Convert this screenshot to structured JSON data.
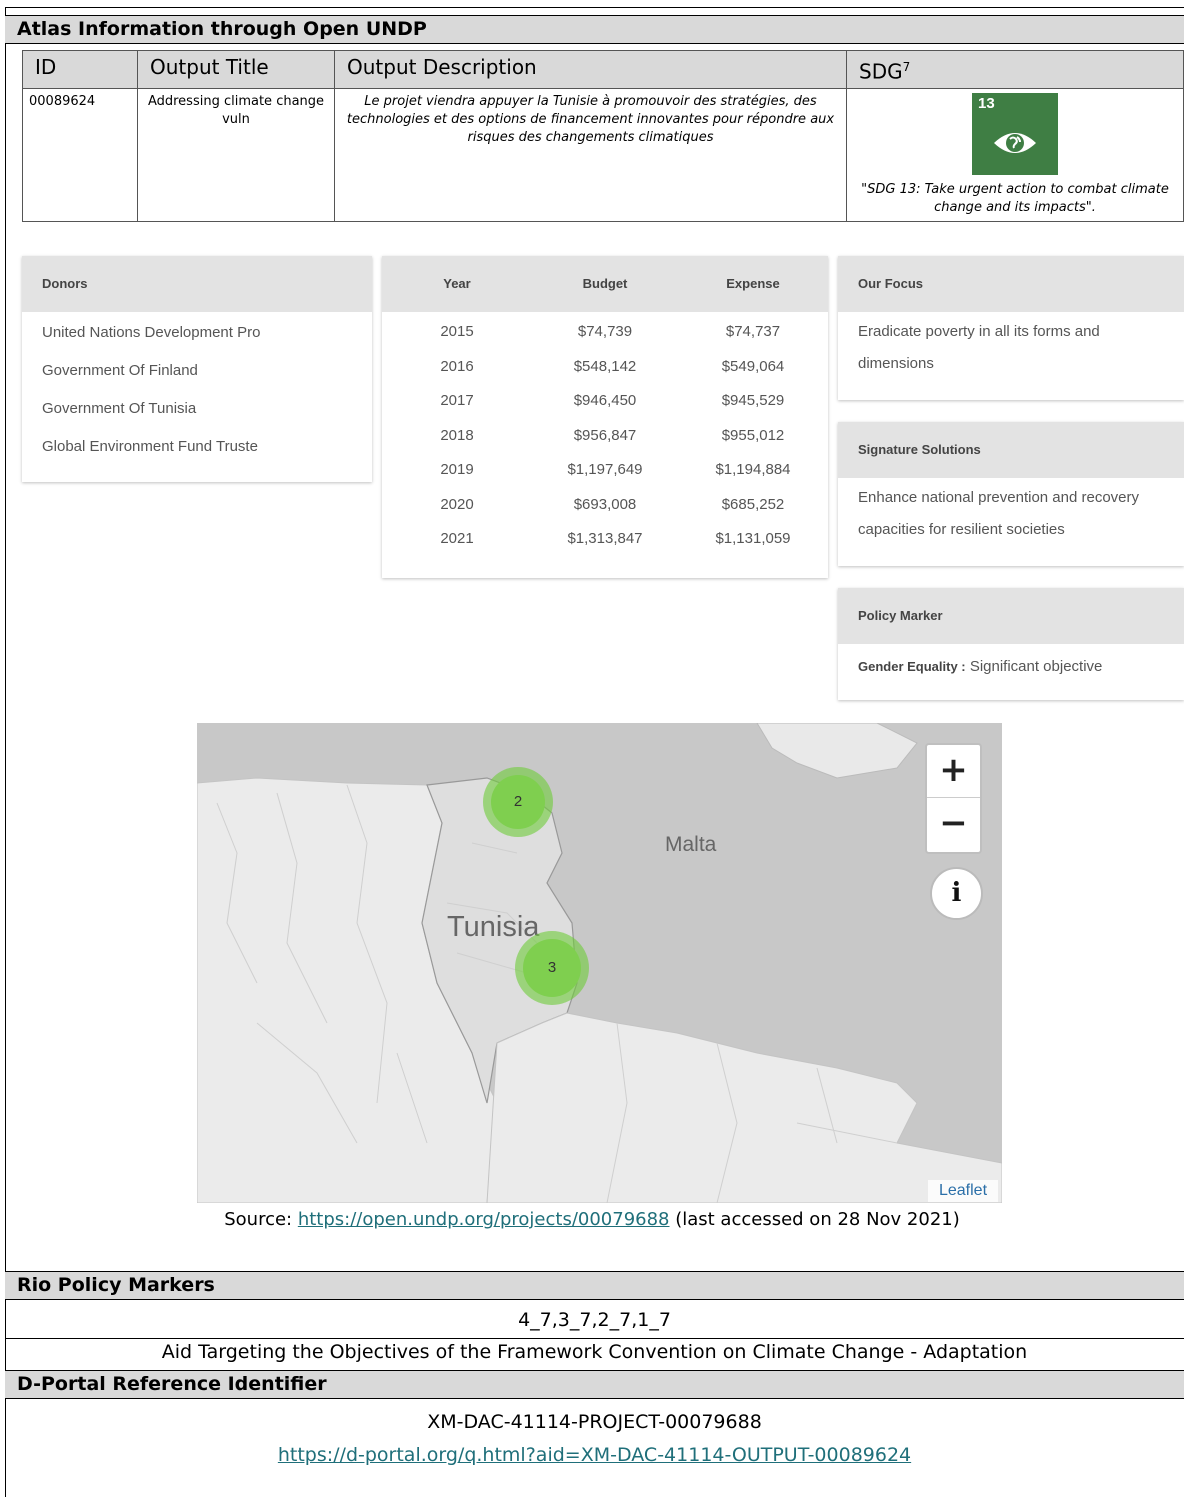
{
  "atlas": {
    "section_title": "Atlas Information through Open UNDP",
    "headers": {
      "id": "ID",
      "title": "Output Title",
      "desc": "Output Description",
      "sdg": "SDG",
      "sdg_sup": "7"
    },
    "row": {
      "id": "00089624",
      "title": "Addressing climate change vuln",
      "desc": "Le projet viendra appuyer la Tunisie à promouvoir des stratégies, des technologies et des options de financement innovantes pour répondre aux risques des changements climatiques",
      "sdg_number": "13",
      "sdg_color": "#3f7e44",
      "sdg_icon": "eye-globe-icon",
      "sdg_caption": "\"SDG 13: Take urgent action to combat climate change and its impacts\"."
    }
  },
  "donors": {
    "title": "Donors",
    "items": [
      "United Nations Development Pro",
      "Government Of Finland",
      "Government Of Tunisia",
      "Global Environment Fund Truste"
    ]
  },
  "finance": {
    "headers": [
      "Year",
      "Budget",
      "Expense"
    ],
    "rows": [
      [
        "2015",
        "$74,739",
        "$74,737"
      ],
      [
        "2016",
        "$548,142",
        "$549,064"
      ],
      [
        "2017",
        "$946,450",
        "$945,529"
      ],
      [
        "2018",
        "$956,847",
        "$955,012"
      ],
      [
        "2019",
        "$1,197,649",
        "$1,194,884"
      ],
      [
        "2020",
        "$693,008",
        "$685,252"
      ],
      [
        "2021",
        "$1,313,847",
        "$1,131,059"
      ]
    ]
  },
  "focus": {
    "title": "Our Focus",
    "text": "Eradicate poverty in all its forms and dimensions"
  },
  "signature": {
    "title": "Signature Solutions",
    "text": "Enhance national prevention and recovery capacities for resilient societies"
  },
  "policy": {
    "title": "Policy Marker",
    "label": "Gender Equality :",
    "value": "Significant objective"
  },
  "map": {
    "labels": {
      "country": "Tunisia",
      "island": "Malta"
    },
    "clusters": [
      "2",
      "3"
    ],
    "zoom_in": "+",
    "zoom_out": "−",
    "info": "i",
    "attribution": "Leaflet",
    "cluster_color": "#7fcf4f"
  },
  "source": {
    "prefix": "Source: ",
    "link": "https://open.undp.org/projects/00079688",
    "suffix": " (last accessed on 28 Nov 2021)"
  },
  "rio": {
    "title": "Rio Policy Markers",
    "codes": "4_7,3_7,2_7,1_7",
    "text": "Aid Targeting the Objectives of the Framework Convention on Climate Change - Adaptation"
  },
  "dportal": {
    "title": "D-Portal Reference Identifier",
    "identifier": "XM-DAC-41114-PROJECT-00079688",
    "link": "https://d-portal.org/q.html?aid=XM-DAC-41114-OUTPUT-00089624"
  }
}
